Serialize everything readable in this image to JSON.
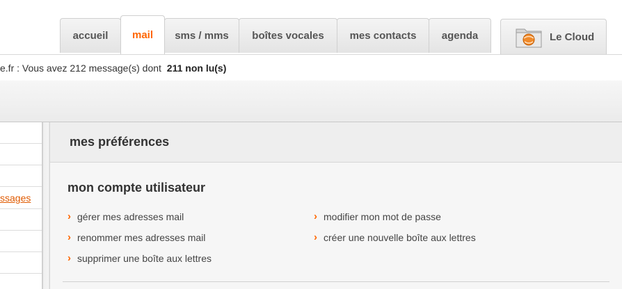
{
  "tabs": [
    {
      "label": "accueil",
      "active": false
    },
    {
      "label": "mail",
      "active": true
    },
    {
      "label": "sms / mms",
      "active": false
    },
    {
      "label": "boîtes vocales",
      "active": false
    },
    {
      "label": "mes contacts",
      "active": false
    },
    {
      "label": "agenda",
      "active": false
    }
  ],
  "cloud": {
    "label": "Le Cloud",
    "icon": "cloud-folder-icon"
  },
  "infobar": {
    "message": "e.fr : Vous avez 212 message(s) dont",
    "unread": "211 non lu(s)"
  },
  "sidebar": {
    "link": "ssages"
  },
  "main": {
    "header": "mes préférences",
    "section_title": "mon compte utilisateur",
    "links_left": [
      "gérer mes adresses mail",
      "renommer mes adresses mail",
      "supprimer une boîte aux lettres"
    ],
    "links_right": [
      "modifier mon mot de passe",
      "créer une nouvelle boîte aux lettres"
    ]
  },
  "colors": {
    "accent": "#ff6600",
    "active_tab_text": "#ff6600"
  }
}
